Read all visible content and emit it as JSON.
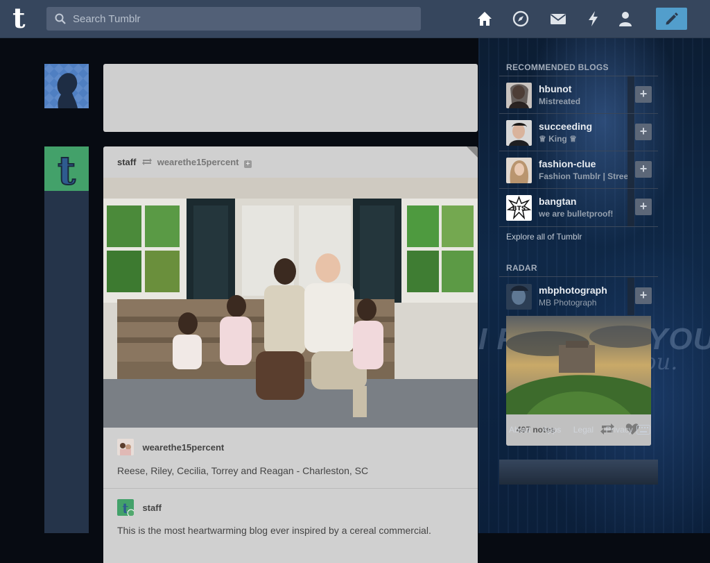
{
  "header": {
    "search_placeholder": "Search Tumblr",
    "logo_letter": "t",
    "nav_icons": [
      "home-icon",
      "explore-compass-icon",
      "inbox-envelope-icon",
      "activity-lightning-icon",
      "account-person-icon"
    ],
    "compose_icon": "pencil-icon"
  },
  "post": {
    "blog_name": "staff",
    "reblogged_from": "wearethe15percent",
    "follow_symbol": "+",
    "attribution_name": "wearethe15percent",
    "caption": "Reese, Riley, Cecilia, Torrey and Reagan - Charleston, SC",
    "staff_name": "staff",
    "body_text": "This is the most heartwarming blog ever inspired by a cereal commercial."
  },
  "sidebar": {
    "recommended_heading": "RECOMMENDED BLOGS",
    "follow_symbol": "+",
    "recommended": [
      {
        "name": "hbunot",
        "title": "Mistreated"
      },
      {
        "name": "succeeding",
        "title": "♕ King ♕"
      },
      {
        "name": "fashion-clue",
        "title": "Fashion Tumblr | Street"
      },
      {
        "name": "bangtan",
        "title": "we are bulletproof!"
      }
    ],
    "explore_link": "Explore all of Tumblr",
    "radar_heading": "RADAR",
    "radar": {
      "name": "mbphotograph",
      "title": "MB Photograph",
      "notes": "497 notes"
    },
    "footer_links": [
      "About",
      "Apps",
      "Legal",
      "Privacy"
    ]
  },
  "background": {
    "overlay_text": "I FORGIVE YOU..",
    "overlay_script": "forgive you."
  },
  "colors": {
    "header": "#36465d",
    "compose": "#529ecc",
    "page_bg": "#070b12"
  }
}
